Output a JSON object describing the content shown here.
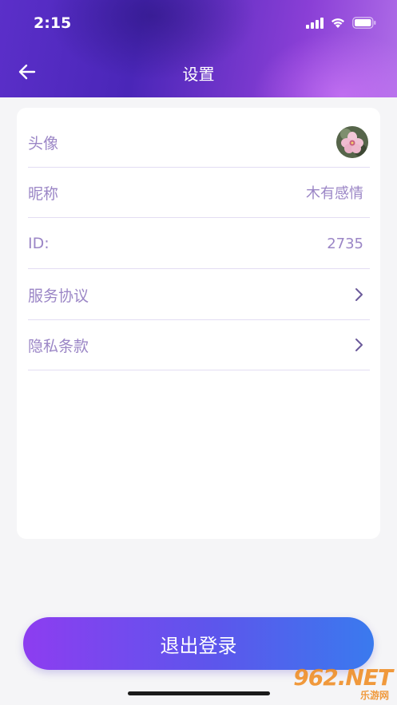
{
  "status_bar": {
    "time": "2:15",
    "icons": [
      "cellular-signal-icon",
      "wifi-icon",
      "battery-icon"
    ]
  },
  "header": {
    "title": "设置",
    "back_icon": "arrow-left-icon"
  },
  "settings": {
    "avatar": {
      "label": "头像"
    },
    "nickname": {
      "label": "昵称",
      "value": "木有感情"
    },
    "id": {
      "label": "ID:",
      "value": "2735"
    },
    "service": {
      "label": "服务协议",
      "icon": "chevron-right-icon"
    },
    "privacy": {
      "label": "隐私条款",
      "icon": "chevron-right-icon"
    }
  },
  "logout": {
    "label": "退出登录"
  },
  "watermark": {
    "main": "962.NET",
    "sub": "乐游网"
  },
  "colors": {
    "accent_start": "#8d3df0",
    "accent_end": "#3a7aee",
    "label": "#9b86c6",
    "divider": "#e3ddf3"
  }
}
